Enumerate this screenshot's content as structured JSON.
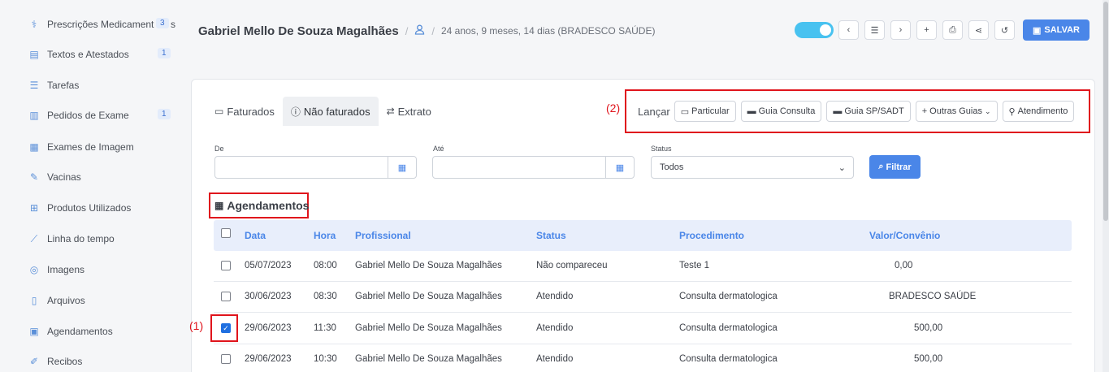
{
  "sidebar": {
    "items": [
      {
        "label": "Prescrições Medicament",
        "suffix": "s",
        "badge": "3",
        "icon": "pills-icon"
      },
      {
        "label": "Textos e Atestados",
        "badge": "1",
        "icon": "document-icon"
      },
      {
        "label": "Tarefas",
        "badge": "",
        "icon": "list-icon"
      },
      {
        "label": "Pedidos de Exame",
        "badge": "1",
        "icon": "building-icon"
      },
      {
        "label": "Exames de Imagem",
        "badge": "",
        "icon": "scan-icon"
      },
      {
        "label": "Vacinas",
        "badge": "",
        "icon": "syringe-icon"
      },
      {
        "label": "Produtos Utilizados",
        "badge": "",
        "icon": "box-icon"
      },
      {
        "label": "Linha do tempo",
        "badge": "",
        "icon": "chart-line-icon"
      },
      {
        "label": "Imagens",
        "badge": "",
        "icon": "camera-icon"
      },
      {
        "label": "Arquivos",
        "badge": "",
        "icon": "file-icon"
      },
      {
        "label": "Agendamentos",
        "badge": "",
        "icon": "calendar-icon"
      },
      {
        "label": "Recibos",
        "badge": "",
        "icon": "edit-icon"
      }
    ]
  },
  "header": {
    "patient_name": "Gabriel Mello De Souza Magalhães",
    "patient_info": "24 anos, 9 meses, 14 dias (BRADESCO SAÚDE)",
    "save_label": "SALVAR"
  },
  "tabs": [
    {
      "label": "Faturados",
      "icon": "cash-icon"
    },
    {
      "label": "Não faturados",
      "icon": "alert-circle-icon"
    },
    {
      "label": "Extrato",
      "icon": "swap-icon"
    }
  ],
  "launch": {
    "label": "Lançar",
    "buttons": [
      {
        "label": "Particular",
        "icon": "cash-icon"
      },
      {
        "label": "Guia Consulta",
        "icon": "card-icon"
      },
      {
        "label": "Guia SP/SADT",
        "icon": "card-icon"
      },
      {
        "label": "+ Outras Guias",
        "icon": "chevron-down-icon"
      },
      {
        "label": "Atendimento",
        "icon": "stethoscope-icon"
      }
    ]
  },
  "filters": {
    "from_label": "De",
    "to_label": "Até",
    "status_label": "Status",
    "status_value": "Todos",
    "filter_button": "Filtrar"
  },
  "annotations": {
    "one": "(1)",
    "two": "(2)"
  },
  "section_title": "Agendamentos",
  "table": {
    "headers": [
      "Data",
      "Hora",
      "Profissional",
      "Status",
      "Procedimento",
      "Valor/Convênio"
    ],
    "rows": [
      {
        "data": "05/07/2023",
        "hora": "08:00",
        "profissional": "Gabriel Mello De Souza Magalhães",
        "status": "Não compareceu",
        "procedimento": "Teste 1",
        "valor": "0,00",
        "checked": false
      },
      {
        "data": "30/06/2023",
        "hora": "08:30",
        "profissional": "Gabriel Mello De Souza Magalhães",
        "status": "Atendido",
        "procedimento": "Consulta dermatologica",
        "valor": "BRADESCO SAÚDE",
        "checked": false
      },
      {
        "data": "29/06/2023",
        "hora": "11:30",
        "profissional": "Gabriel Mello De Souza Magalhães",
        "status": "Atendido",
        "procedimento": "Consulta dermatologica",
        "valor": "500,00",
        "checked": true
      },
      {
        "data": "29/06/2023",
        "hora": "10:30",
        "profissional": "Gabriel Mello De Souza Magalhães",
        "status": "Atendido",
        "procedimento": "Consulta dermatologica",
        "valor": "500,00",
        "checked": false
      }
    ]
  },
  "colors": {
    "accent": "#4a86e8",
    "highlight": "#e0141c",
    "toggle": "#48c2f0"
  }
}
